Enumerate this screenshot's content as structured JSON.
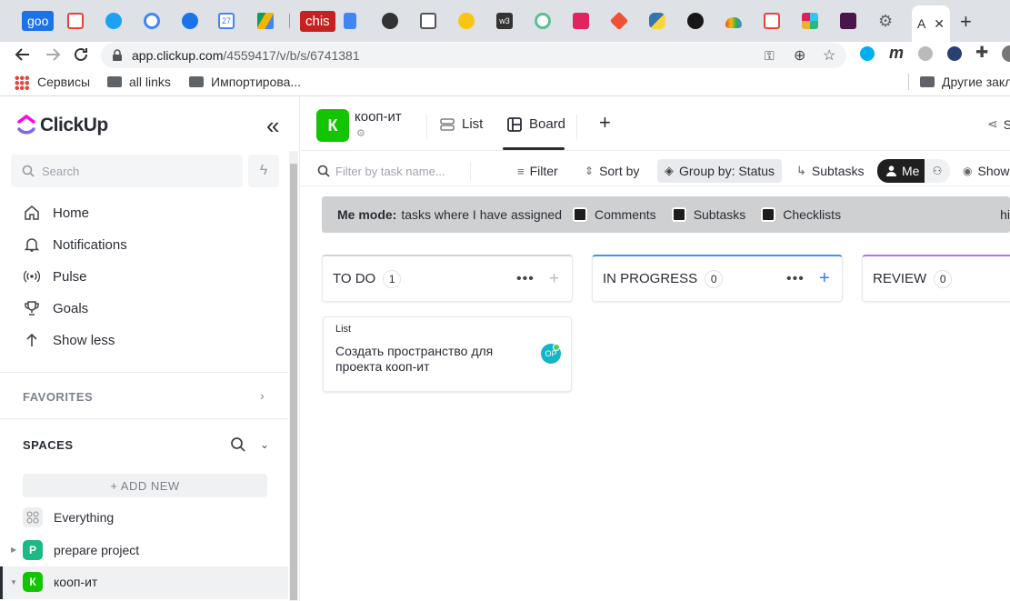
{
  "browser": {
    "tabs": [
      {
        "label": "goo",
        "color": "#1a73e8"
      },
      {
        "label": "",
        "color": "#ea4335"
      },
      {
        "label": "",
        "color": "#1da1f2"
      },
      {
        "label": "",
        "color": "#4285f4"
      },
      {
        "label": "",
        "color": "#1a73e8"
      },
      {
        "label": "27",
        "color": "#4285f4"
      },
      {
        "label": "",
        "color": "#0f9d58"
      },
      {
        "label": "chis",
        "color": "#c5221f"
      },
      {
        "label": "",
        "color": "#4285f4"
      },
      {
        "label": "",
        "color": "#333333"
      },
      {
        "label": "",
        "color": "#555555"
      },
      {
        "label": "",
        "color": "#f9c513"
      },
      {
        "label": "w3",
        "color": "#333333"
      },
      {
        "label": "",
        "color": "#5cbf91"
      },
      {
        "label": "",
        "color": "#e0245e"
      },
      {
        "label": "",
        "color": "#f05033"
      },
      {
        "label": "",
        "color": "#3776ab"
      },
      {
        "label": "",
        "color": "#181717"
      },
      {
        "label": "",
        "color": "#4285f4"
      },
      {
        "label": "",
        "color": "#ea4335"
      },
      {
        "label": "",
        "color": "#4a154b"
      },
      {
        "label": "",
        "color": "#4a154b"
      },
      {
        "label": "",
        "color": "#5f6368"
      }
    ],
    "active_tab_label": "A",
    "new_tab": "+",
    "url_domain": "app.clickup.com",
    "url_path": "/4559417/v/b/s/6741381",
    "bookmarks": {
      "apps": "Сервисы",
      "all_links": "all links",
      "imported": "Импортирова...",
      "other": "Другие закладки"
    }
  },
  "sidebar": {
    "logo": "ClickUp",
    "collapse_icon": "«",
    "search_placeholder": "Search",
    "nav": [
      {
        "label": "Home",
        "icon": "home-icon"
      },
      {
        "label": "Notifications",
        "icon": "bell-icon"
      },
      {
        "label": "Pulse",
        "icon": "pulse-icon"
      },
      {
        "label": "Goals",
        "icon": "trophy-icon"
      },
      {
        "label": "Show less",
        "icon": "arrow-up-icon"
      }
    ],
    "favorites_label": "FAVORITES",
    "spaces_label": "SPACES",
    "add_new_label": "+ ADD NEW",
    "spaces": [
      {
        "label": "Everything",
        "avatar": ""
      },
      {
        "label": "prepare project",
        "avatar": "P",
        "color": "#1db954"
      },
      {
        "label": "кооп-ит",
        "avatar": "К",
        "color": "#13c400"
      }
    ]
  },
  "header": {
    "space_avatar": "К",
    "space_color": "#13c400",
    "space_name": "кооп-ит",
    "views": [
      {
        "label": "List"
      },
      {
        "label": "Board"
      }
    ],
    "add_view": "+",
    "share": "S"
  },
  "toolbar": {
    "filter_placeholder": "Filter by task name...",
    "filter": "Filter",
    "sort": "Sort by",
    "group": "Group by: Status",
    "subtasks": "Subtasks",
    "me": "Me",
    "show": "Show"
  },
  "me_banner": {
    "title": "Me mode:",
    "text": "tasks where I have assigned",
    "options": [
      "Comments",
      "Subtasks",
      "Checklists"
    ],
    "hide": "hi"
  },
  "columns": [
    {
      "name": "TO DO",
      "count": "1",
      "accent": "#d3d3d3"
    },
    {
      "name": "IN PROGRESS",
      "count": "0",
      "accent": "#4194f6"
    },
    {
      "name": "REVIEW",
      "count": "0",
      "accent": "#a875ff"
    }
  ],
  "card": {
    "list": "List",
    "title": "Создать пространство для проекта кооп-ит",
    "assignee": "OP",
    "assignee_color": "#13b5c7"
  }
}
